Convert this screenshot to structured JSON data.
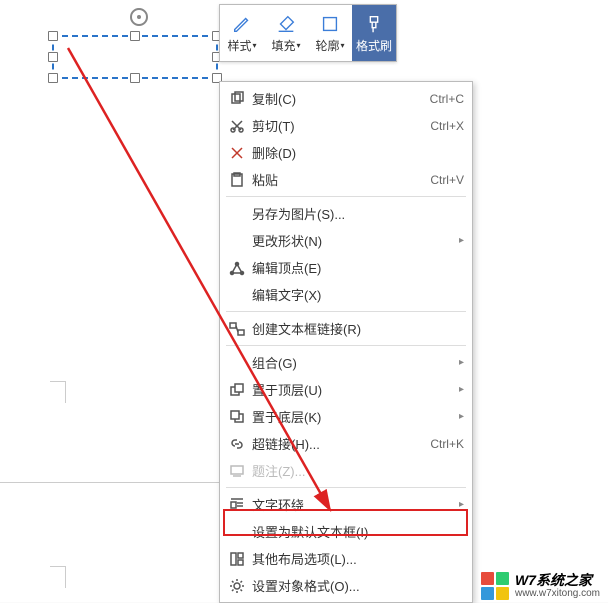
{
  "toolbar": {
    "style": "样式",
    "fill": "填充",
    "outline": "轮廓",
    "format_painter": "格式刷"
  },
  "menu": {
    "copy": {
      "label": "复制(C)",
      "shortcut": "Ctrl+C"
    },
    "cut": {
      "label": "剪切(T)",
      "shortcut": "Ctrl+X"
    },
    "delete": {
      "label": "删除(D)"
    },
    "paste": {
      "label": "粘贴",
      "shortcut": "Ctrl+V"
    },
    "save_as_image": {
      "label": "另存为图片(S)..."
    },
    "change_shape": {
      "label": "更改形状(N)"
    },
    "edit_vertex": {
      "label": "编辑顶点(E)"
    },
    "edit_text": {
      "label": "编辑文字(X)"
    },
    "create_textbox_link": {
      "label": "创建文本框链接(R)"
    },
    "group": {
      "label": "组合(G)"
    },
    "bring_forward": {
      "label": "置于顶层(U)"
    },
    "send_backward": {
      "label": "置于底层(K)"
    },
    "hyperlink": {
      "label": "超链接(H)...",
      "shortcut": "Ctrl+K"
    },
    "caption": {
      "label": "题注(Z)..."
    },
    "text_wrap": {
      "label": "文字环绕"
    },
    "set_default_textbox": {
      "label": "设置为默认文本框(I)"
    },
    "more_layout": {
      "label": "其他布局选项(L)..."
    },
    "format_object": {
      "label": "设置对象格式(O)..."
    }
  },
  "watermark": {
    "title": "W7系统之家",
    "url": "www.w7xitong.com"
  }
}
